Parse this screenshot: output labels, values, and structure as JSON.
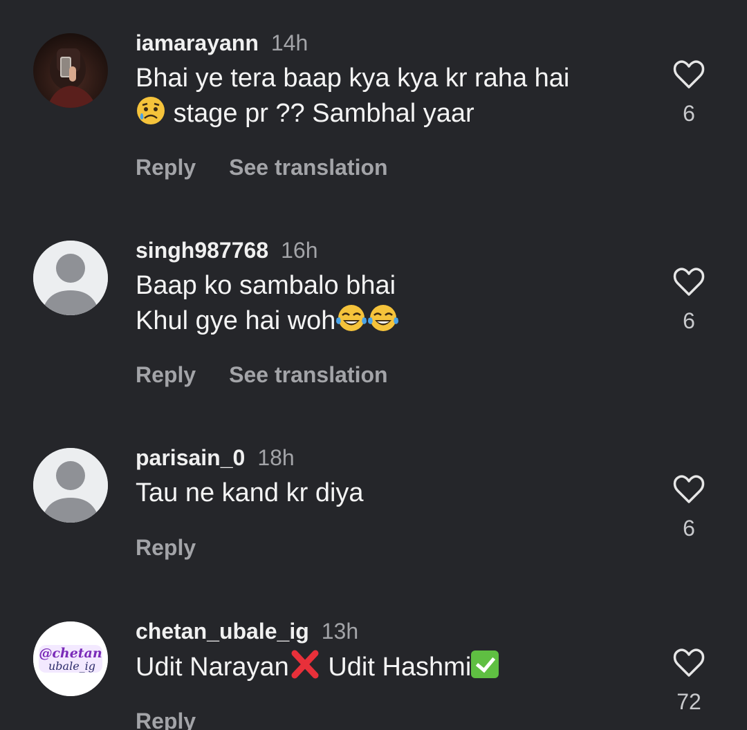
{
  "comments": [
    {
      "username": "iamarayann",
      "time": "14h",
      "lines": [
        "Bhai ye tera baap kya kya kr raha hai",
        "stage pr ?? Sambhal yaar"
      ],
      "reply": "Reply",
      "translate": "See translation",
      "likes": "6",
      "avatar": "profile-photo",
      "emoji": "sad-but-relieved-face"
    },
    {
      "username": "singh987768",
      "time": "16h",
      "lines": [
        "Baap ko sambalo bhai",
        "Khul gye hai woh"
      ],
      "reply": "Reply",
      "translate": "See translation",
      "likes": "6",
      "avatar": "default-avatar",
      "emoji": "tears-of-joy-face"
    },
    {
      "username": "parisain_0",
      "time": "18h",
      "lines": [
        "Tau ne kand kr diya"
      ],
      "reply": "Reply",
      "likes": "6",
      "avatar": "default-avatar"
    },
    {
      "username": "chetan_ubale_ig",
      "time": "13h",
      "lines": [
        "Udit Narayan",
        "Udit Hashmi"
      ],
      "reply": "Reply",
      "likes": "72",
      "avatar": "logo-avatar",
      "avatar_text": [
        "@chetan",
        "ubale_ig"
      ]
    }
  ],
  "colors": {
    "background": "#25262a",
    "secondary_text": "#a3a4a8",
    "primary_text": "#f4f4f4"
  },
  "icons": [
    "heart-icon",
    "default-avatar-icon",
    "cross-mark-emoji",
    "check-mark-emoji"
  ]
}
